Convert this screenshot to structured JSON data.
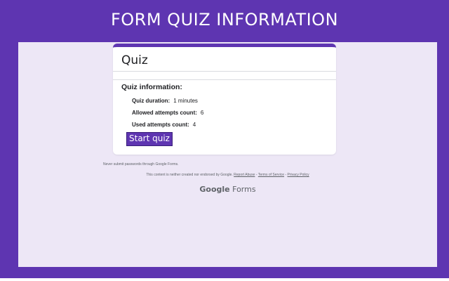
{
  "header": {
    "title": "FORM QUIZ INFORMATION"
  },
  "card": {
    "title": "Quiz",
    "section_heading": "Quiz information:",
    "rows": [
      {
        "label": "Quiz duration:",
        "value": "1 minutes"
      },
      {
        "label": "Allowed attempts count:",
        "value": "6"
      },
      {
        "label": "Used attempts count:",
        "value": "4"
      }
    ],
    "start_button_label": "Start quiz"
  },
  "footer": {
    "password_note": "Never submit passwords through Google Forms.",
    "disclaimer_prefix": "This content is neither created nor endorsed by Google.",
    "report_abuse": "Report Abuse",
    "sep1": " - ",
    "terms": "Terms of Service",
    "sep2": " - ",
    "privacy": "Privacy Policy",
    "brand_google": "Google",
    "brand_forms": "Forms"
  },
  "colors": {
    "accent": "#5e35b1",
    "content_bg": "#ede7f6",
    "card_bg": "#ffffff"
  }
}
